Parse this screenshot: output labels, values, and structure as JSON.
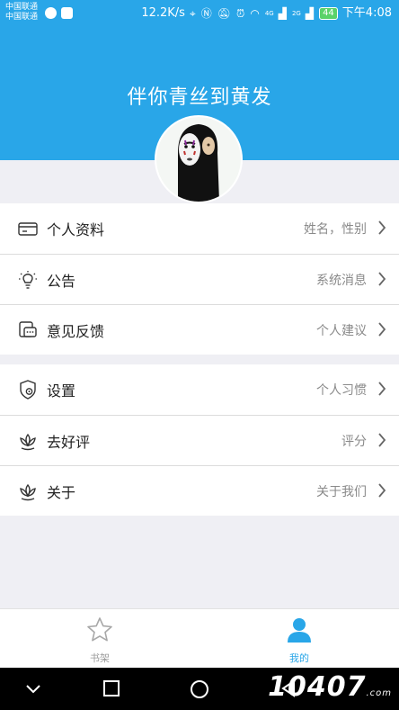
{
  "status_bar": {
    "carrier_1": "中国联通",
    "carrier_2": "中国联通",
    "speed": "12.2K/s",
    "signal_1": "4G",
    "signal_2": "2G",
    "battery": "44",
    "time": "下午4:08"
  },
  "header": {
    "title": "伴你青丝到黄发"
  },
  "menu_group_1": [
    {
      "label": "个人资料",
      "hint": "姓名，性别",
      "icon": "id-card-icon"
    },
    {
      "label": "公告",
      "hint": "系统消息",
      "icon": "lightbulb-icon"
    },
    {
      "label": "意见反馈",
      "hint": "个人建议",
      "icon": "feedback-icon"
    }
  ],
  "menu_group_2": [
    {
      "label": "设置",
      "hint": "个人习惯",
      "icon": "settings-shield-icon"
    },
    {
      "label": "去好评",
      "hint": "评分",
      "icon": "lotus-icon"
    },
    {
      "label": "关于",
      "hint": "关于我们",
      "icon": "lotus-icon"
    }
  ],
  "tabbar": {
    "shelf": "书架",
    "me": "我的"
  },
  "watermark": {
    "big": "10407",
    "small": ".com"
  },
  "colors": {
    "accent": "#29a6e8",
    "background": "#efeff4"
  }
}
